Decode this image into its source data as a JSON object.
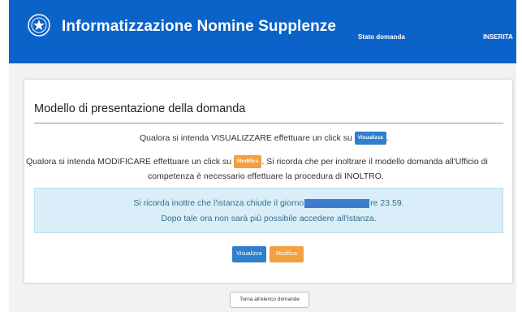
{
  "header": {
    "app_title": "Informatizzazione Nomine Supplenze",
    "status_label": "Stato domanda",
    "status_value": "INSERITA",
    "emblem_icon": "italian-republic-emblem-icon"
  },
  "card": {
    "title": "Modello di presentazione della domanda",
    "line1_pre": "Qualora si intenda VISUALIZZARE effettuare un click su",
    "line1_chip": "Visualizza",
    "line1_post": ".",
    "line2_pre": "Qualora si intenda MODIFICARE effettuare un click su",
    "line2_chip": "Modifica",
    "line2_post": ". Si ricorda che per inoltrare il modello domanda all'Ufficio di",
    "line3": "competenza è necessario effettuare la procedura di INOLTRO.",
    "notice": {
      "line1_pre": "Si ricorda inoltre che l'istanza chiude il giorno",
      "line1_post": "re 23.59.",
      "line2": "Dopo tale ora non sarà più possibile accedere all'istanza."
    },
    "buttons": {
      "visualizza": "Visualizza",
      "modifica": "Modifica"
    }
  },
  "back_button": "Torna all'elenco domande",
  "colors": {
    "header": "#0b63c9",
    "blue_button": "#2f7fcd",
    "orange_button": "#f2a040",
    "notice_bg": "#d9eef8",
    "notice_text": "#31708f"
  }
}
